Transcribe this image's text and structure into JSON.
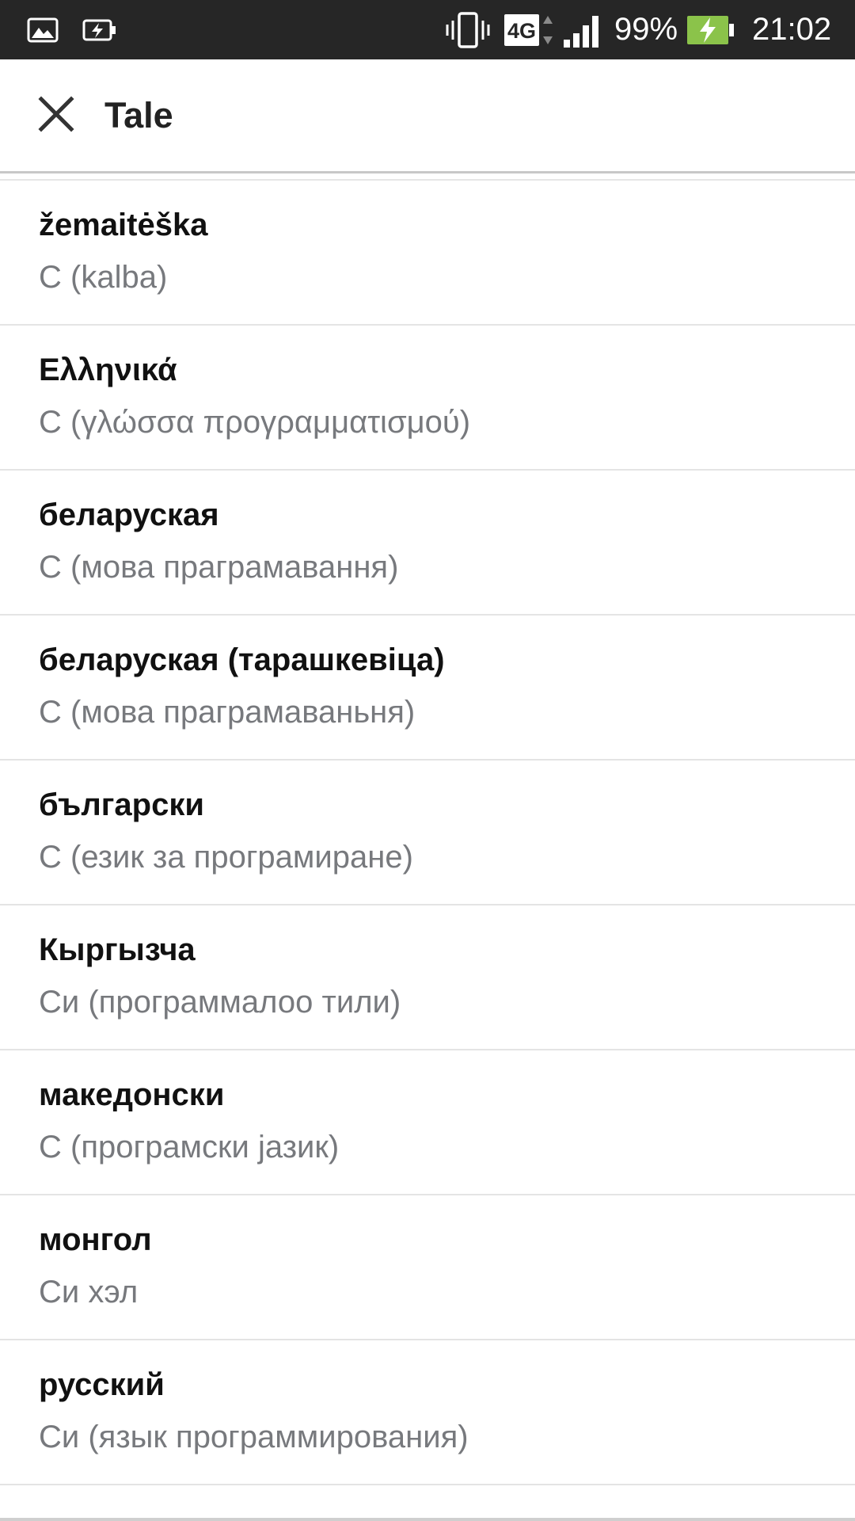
{
  "status_bar": {
    "battery_percent": "99%",
    "time": "21:02",
    "network": "4G",
    "icons": [
      "gallery-icon",
      "battery-saver-icon",
      "vibrate-icon",
      "network-4g-icon",
      "signal-icon",
      "battery-charging-icon"
    ],
    "battery_color": "#8bc34a"
  },
  "app_bar": {
    "title": "Tale",
    "close_icon": "close-icon"
  },
  "languages": [
    {
      "name": "žemaitėška",
      "title": "C (kalba)"
    },
    {
      "name": "Ελληνικά",
      "title": "C (γλώσσα προγραμματισμού)"
    },
    {
      "name": "беларуская",
      "title": "C (мова праграмавання)"
    },
    {
      "name": "беларуская (тарашкевіца)",
      "title": "C (мова праграмаваньня)"
    },
    {
      "name": "български",
      "title": "C (език за програмиране)"
    },
    {
      "name": "Кыргызча",
      "title": "Си (программалоо тили)"
    },
    {
      "name": "македонски",
      "title": "C (програмски јазик)"
    },
    {
      "name": "монгол",
      "title": "Си хэл"
    },
    {
      "name": "русский",
      "title": "Си (язык программирования)"
    }
  ]
}
